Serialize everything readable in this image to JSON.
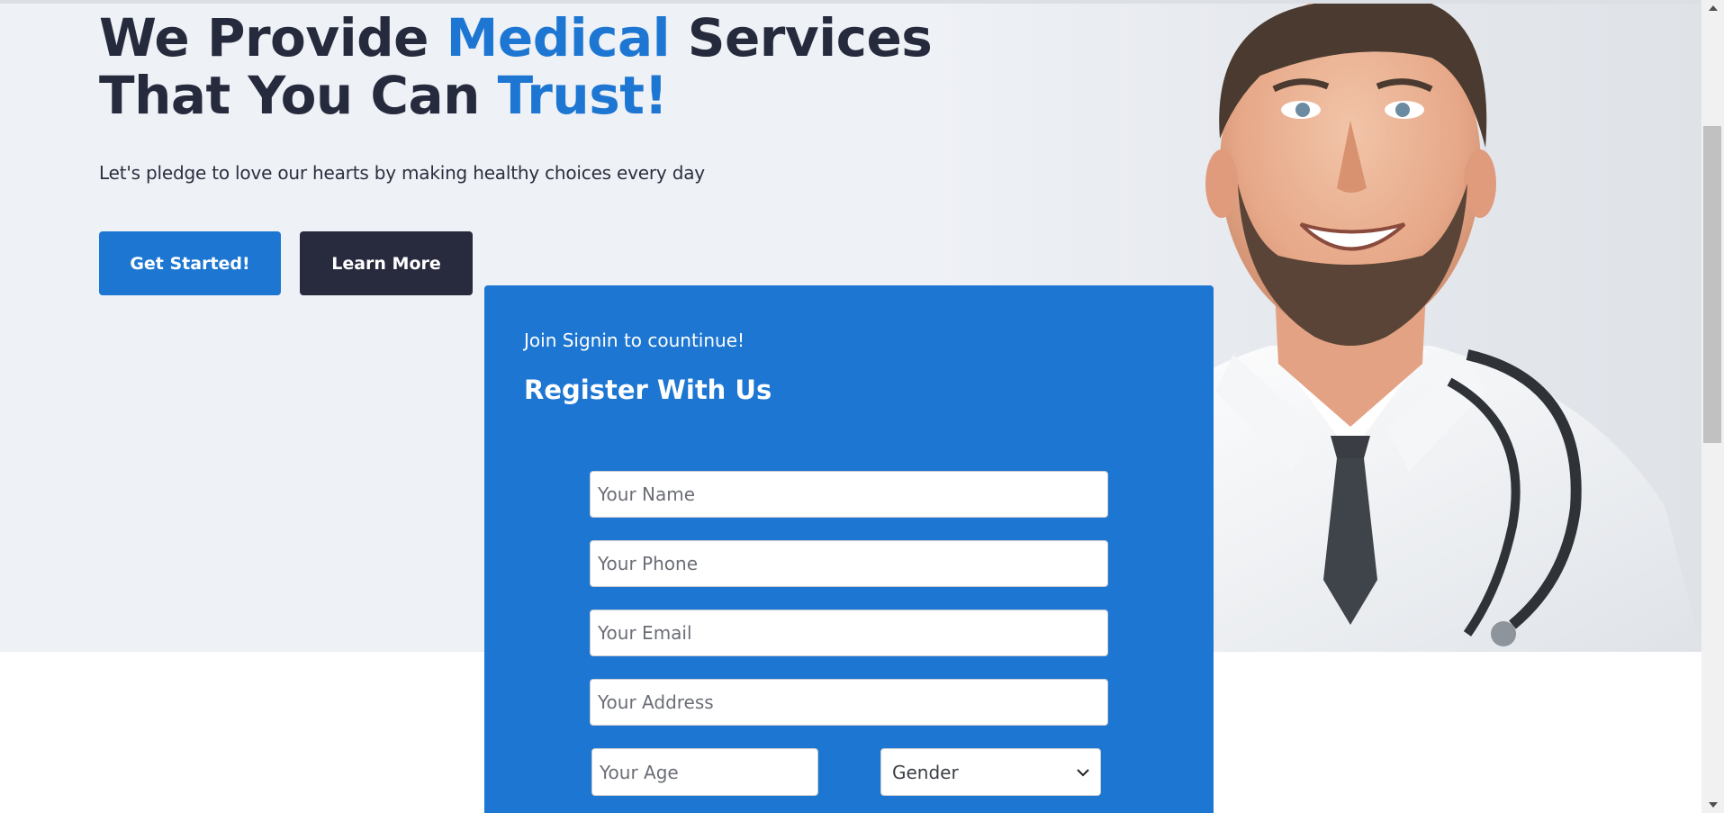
{
  "hero": {
    "headline_line1_pre": "We Provide ",
    "headline_line1_accent": "Medical",
    "headline_line1_post": " Services",
    "headline_line2_pre": "That You Can ",
    "headline_line2_accent": "Trust!",
    "subtext": "Let's pledge to love our hearts by making healthy choices every day",
    "primary_button": "Get Started!",
    "secondary_button": "Learn More"
  },
  "register": {
    "subtitle": "Join Signin to countinue!",
    "title": "Register With Us",
    "name_placeholder": "Your Name",
    "phone_placeholder": "Your Phone",
    "email_placeholder": "Your Email",
    "address_placeholder": "Your Address",
    "age_placeholder": "Your Age",
    "gender_selected": "Gender"
  },
  "colors": {
    "accent": "#1d76d2",
    "dark": "#282a3e",
    "hero_bg": "#eef1f5"
  },
  "icons": {
    "gender_dropdown": "chevron-down-icon",
    "scroll_up": "triangle-up-icon",
    "scroll_down": "triangle-down-icon"
  }
}
